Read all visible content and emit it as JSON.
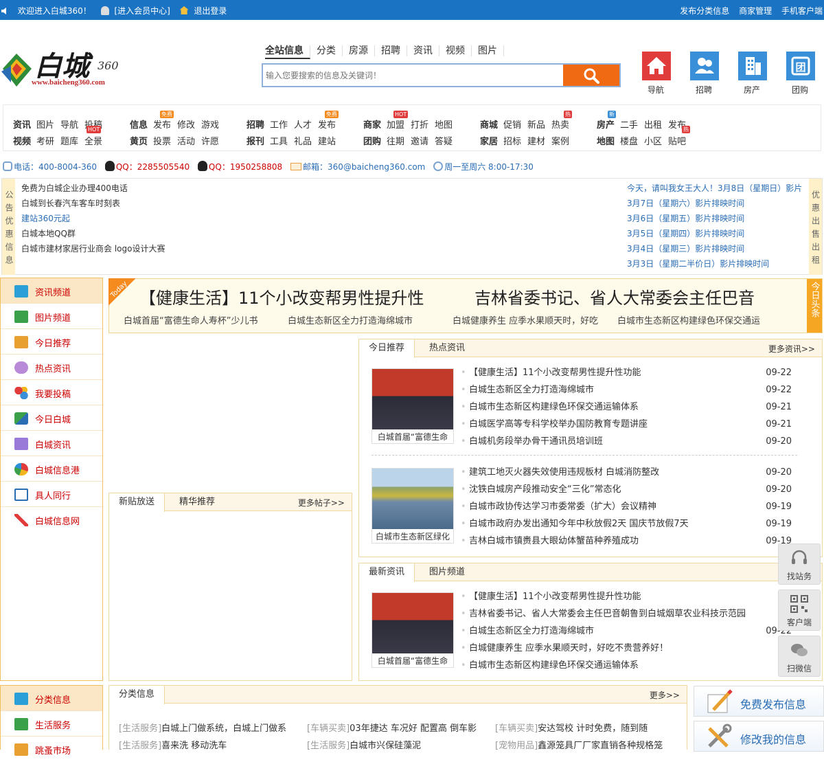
{
  "topbar": {
    "welcome": "欢迎进入白城360！",
    "member": "[进入会员中心]",
    "logout": "退出登录",
    "links": [
      "发布分类信息",
      "商家管理",
      "手机客户端"
    ]
  },
  "logo": {
    "name": "白城",
    "suffix": "360",
    "url": "www.baicheng360.com"
  },
  "search": {
    "tabs": [
      "全站信息",
      "分类",
      "房源",
      "招聘",
      "资讯",
      "视频",
      "图片"
    ],
    "placeholder": "输入您要搜索的信息及关键词！"
  },
  "quick_icons": [
    {
      "label": "导航",
      "icon": "home-icon",
      "color": "#e03c3c"
    },
    {
      "label": "招聘",
      "icon": "people-icon",
      "color": "#3a90d8"
    },
    {
      "label": "房产",
      "icon": "building-icon",
      "color": "#3a90d8"
    },
    {
      "label": "团购",
      "icon": "group-icon",
      "color": "#3a90d8"
    }
  ],
  "catnav": [
    {
      "row1": {
        "head": "资讯",
        "items": [
          "图片",
          "导航",
          "投稿"
        ]
      },
      "row2": {
        "head": "视频",
        "items": [
          "考研",
          "题库",
          "全景"
        ]
      }
    },
    {
      "row1": {
        "head": "信息",
        "items": [
          "发布",
          "修改",
          "游戏"
        ]
      },
      "row2": {
        "head": "黄页",
        "items": [
          "投票",
          "活动",
          "许愿"
        ]
      }
    },
    {
      "row1": {
        "head": "招聘",
        "items": [
          "工作",
          "人才",
          "发布"
        ]
      },
      "row2": {
        "head": "报刊",
        "items": [
          "工具",
          "礼品",
          "建站"
        ]
      }
    },
    {
      "row1": {
        "head": "商家",
        "items": [
          "加盟",
          "打折",
          "地图"
        ]
      },
      "row2": {
        "head": "团购",
        "items": [
          "往期",
          "邀请",
          "答疑"
        ]
      }
    },
    {
      "row1": {
        "head": "商城",
        "items": [
          "促销",
          "新品",
          "热卖"
        ]
      },
      "row2": {
        "head": "家居",
        "items": [
          "招标",
          "建材",
          "案例"
        ]
      }
    },
    {
      "row1": {
        "head": "房产",
        "items": [
          "二手",
          "出租",
          "发布"
        ]
      },
      "row2": {
        "head": "地图",
        "items": [
          "楼盘",
          "小区",
          "贴吧"
        ]
      }
    }
  ],
  "badges": {
    "free": "免费",
    "hot": "HOT",
    "hot_cn": "热",
    "new": "新"
  },
  "contact": {
    "phone": "电话：400-8004-360",
    "qq1": "QQ：2285505540",
    "qq2": "QQ：1950258808",
    "email": "邮箱：360@baicheng360.com",
    "hours": "周一至周六 8:00-17:30"
  },
  "notice": {
    "left_tab": "公告优惠信息",
    "right_tab": "优惠出售出租",
    "left": [
      "免费为白城企业办理400电话",
      "白城到长春汽车客车时刻表",
      "建站360元起",
      "白城本地QQ群",
      "白城市建材家居行业商会 logo设计大赛"
    ],
    "right": [
      "今天，请叫我女王大人！3月8日（星期日）影片",
      "3月7日（星期六）影片排映时间",
      "3月6日（星期五）影片排映时间",
      "3月5日（星期四）影片排映时间",
      "3月4日（星期三）影片排映时间",
      "3月3日（星期二半价日）影片排映时间"
    ]
  },
  "sidebar": [
    "资讯频道",
    "图片频道",
    "今日推荐",
    "热点资讯",
    "我要投稿",
    "今日白城",
    "白城资讯",
    "白城信息港",
    "具人同行",
    "白城信息网"
  ],
  "headline": {
    "badge": "Today",
    "big1": "【健康生活】11个小改变帮男性提升性",
    "big2": "吉林省委书记、省人大常委会主任巴音",
    "subs": [
      "白城首届“富德生命人寿杯”少儿书",
      "白城生态新区全力打造海绵城市",
      "白城健康养生 应季水果顺天时，好吃",
      "白城市生态新区构建绿色环保交通运"
    ],
    "side_tag": "今日头条"
  },
  "posts_panel": {
    "tabs": [
      "新贴放送",
      "精华推荐"
    ],
    "more": "更多帖子>>"
  },
  "news_panel": {
    "tabs": [
      "今日推荐",
      "热点资讯"
    ],
    "more": "更多资讯>>",
    "thumb1": "白城首届“富德生命",
    "thumb2": "白城市生态新区绿化",
    "list1": [
      {
        "t": "【健康生活】11个小改变帮男性提升性功能",
        "d": "09-22"
      },
      {
        "t": "白城生态新区全力打造海绵城市",
        "d": "09-22"
      },
      {
        "t": "白城市生态新区构建绿色环保交通运输体系",
        "d": "09-21"
      },
      {
        "t": "白城医学高等专科学校举办国防教育专题讲座",
        "d": "09-21"
      },
      {
        "t": "白城机务段举办骨干通讯员培训班",
        "d": "09-20"
      }
    ],
    "list2": [
      {
        "t": "建筑工地灭火器失效使用违规板材 白城消防整改",
        "d": "09-20"
      },
      {
        "t": "沈铁白城房产段推动安全“三化”常态化",
        "d": "09-20"
      },
      {
        "t": "白城市政协传达学习市委常委（扩大）会议精神",
        "d": "09-19"
      },
      {
        "t": "白城市政府办发出通知今年中秋放假2天 国庆节放假7天",
        "d": "09-19"
      },
      {
        "t": "吉林白城市镇赉县大眼幼体蟹苗种养殖成功",
        "d": "09-19"
      }
    ]
  },
  "latest_panel": {
    "tabs": [
      "最新资讯",
      "图片频道"
    ],
    "more": "更",
    "thumb": "白城首届“富德生命",
    "list": [
      {
        "t": "【健康生活】11个小改变帮男性提升性功能",
        "d": "09"
      },
      {
        "t": "吉林省委书记、省人大常委会主任巴音朝鲁到白城烟草农业科技示范园",
        "d": "09"
      },
      {
        "t": "白城生态新区全力打造海绵城市",
        "d": "09-22"
      },
      {
        "t": "白城健康养生 应季水果顺天时，好吃不贵营养好！",
        "d": "09"
      },
      {
        "t": "白城市生态新区构建绿色环保交通运输体系",
        "d": "09"
      }
    ]
  },
  "float_tools": [
    "找站务",
    "客户端",
    "扫微信"
  ],
  "sidebar2": [
    "分类信息",
    "生活服务",
    "跳蚤市场"
  ],
  "classified": {
    "title": "分类信息",
    "more": "更多>>",
    "row1": [
      {
        "tag": "[生活服务]",
        "t": "白城上门做系统，白城上门做系"
      },
      {
        "tag": "[车辆买卖]",
        "t": "03年捷达 车况好 配置高 倒车影"
      },
      {
        "tag": "[车辆买卖]",
        "t": "安达驾校 计时免费，随到随"
      }
    ],
    "row2": [
      {
        "tag": "[生活服务]",
        "t": "喜来洗 移动洗车"
      },
      {
        "tag": "[生活服务]",
        "t": "白城市兴保硅藻泥"
      },
      {
        "tag": "[宠物用品]",
        "t": "鑫源笼具厂厂家直销各种规格笼"
      }
    ]
  },
  "right_ads": [
    "免费发布信息",
    "修改我的信息"
  ]
}
